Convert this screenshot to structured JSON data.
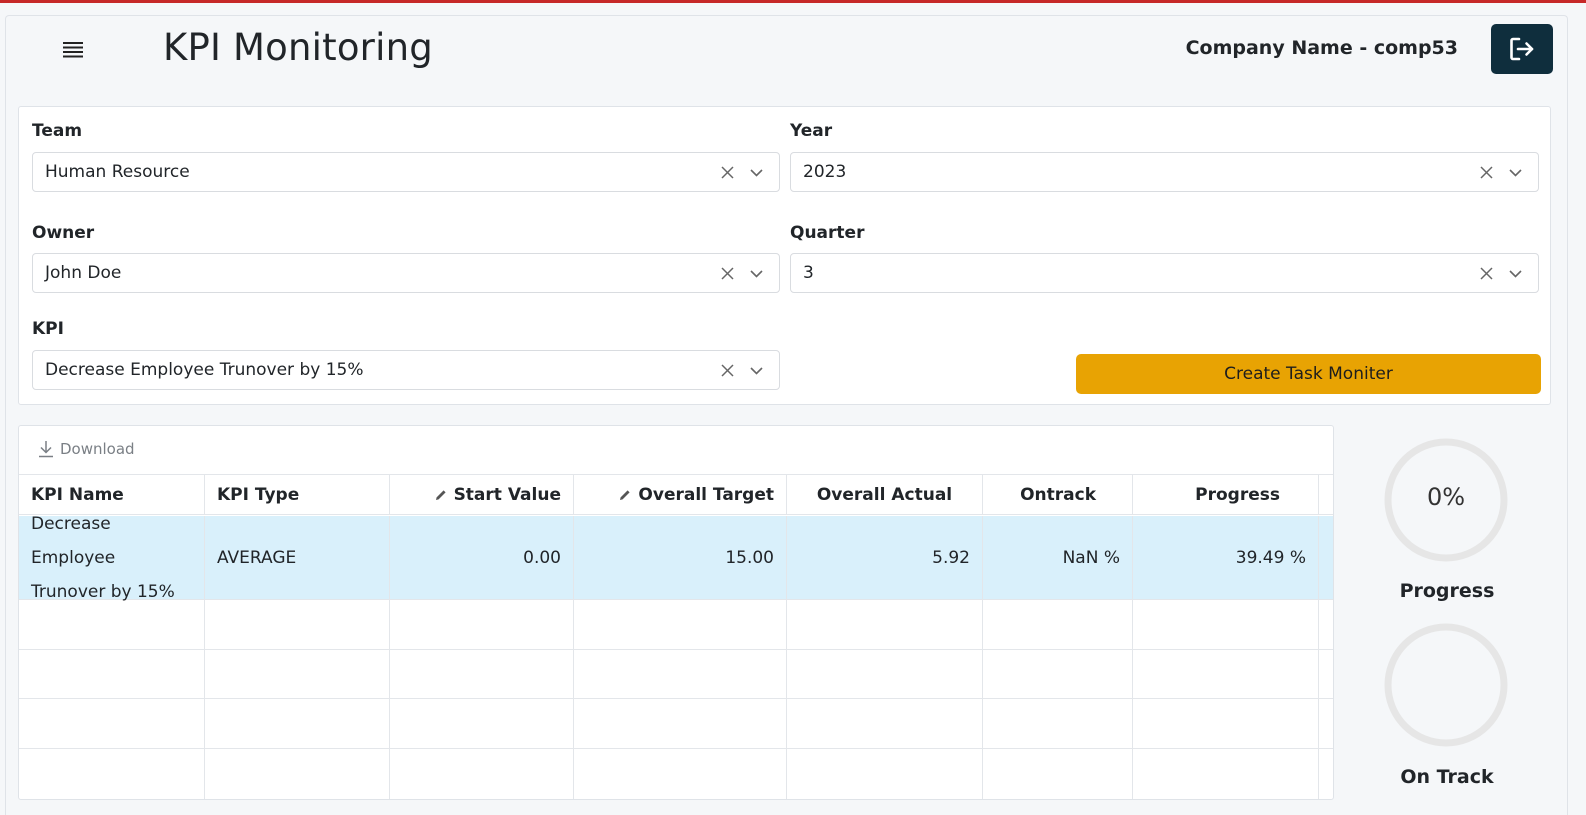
{
  "header": {
    "title": "KPI Monitoring",
    "company": "Company Name - comp53",
    "menu_icon": "list-icon",
    "logout_icon": "logout-icon"
  },
  "filters": {
    "team": {
      "label": "Team",
      "value": "Human Resource"
    },
    "year": {
      "label": "Year",
      "value": "2023"
    },
    "owner": {
      "label": "Owner",
      "value": "John Doe"
    },
    "quarter": {
      "label": "Quarter",
      "value": "3"
    },
    "kpi": {
      "label": "KPI",
      "value": "Decrease Employee Trunover by 15%"
    },
    "create_button": "Create Task Moniter"
  },
  "grid": {
    "download_label": "Download",
    "columns": [
      "KPI Name",
      "KPI Type",
      "Start Value",
      "Overall Target",
      "Overall Actual",
      "Ontrack",
      "Progress"
    ],
    "rows": [
      [
        "Decrease Employee Trunover by 15%",
        "AVERAGE",
        "0.00",
        "15.00",
        "5.92",
        "NaN %",
        "39.49 %"
      ]
    ]
  },
  "gauges": {
    "progress": {
      "text": "0%",
      "label": "Progress",
      "value": 0
    },
    "on_track": {
      "text": "",
      "label": "On Track"
    }
  },
  "colors": {
    "accent_bar": "#c62828",
    "logout_bg": "#0f2e3d",
    "create_button_bg": "#e8a303",
    "selected_row_bg": "#d9f0fb",
    "gauge_track": "#e6e6e6"
  }
}
